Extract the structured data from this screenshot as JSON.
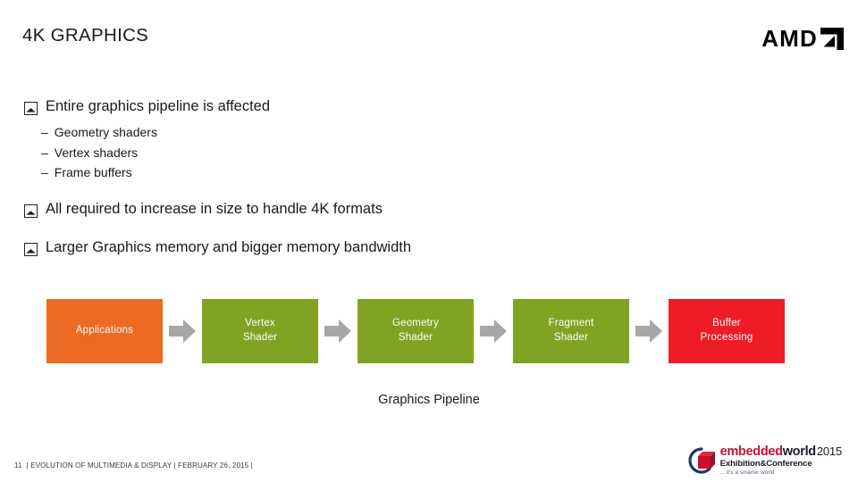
{
  "header": {
    "title": "4K GRAPHICS",
    "logo": {
      "name": "amd-logo",
      "wordmark": "AMD",
      "mark": "amd-arrow-icon"
    }
  },
  "content": {
    "bullets": [
      {
        "text": "Entire graphics pipeline is affected",
        "sub_items": [
          {
            "dash": "–",
            "text": "Geometry shaders"
          },
          {
            "dash": "–",
            "text": "Vertex shaders"
          },
          {
            "dash": "–",
            "text": "Frame buffers"
          }
        ]
      },
      {
        "text": "All required to increase in size to handle 4K formats",
        "sub_items": []
      },
      {
        "text": "Larger Graphics memory and bigger memory bandwidth",
        "sub_items": []
      }
    ],
    "bullet_glyph_name": "square-caret-bullet-icon"
  },
  "diagram": {
    "caption": "Graphics Pipeline",
    "arrow_color": "#A6A6A6",
    "stages": [
      {
        "label_lines": [
          "Applications"
        ],
        "color": "#ED6A23"
      },
      {
        "label_lines": [
          "Vertex",
          "Shader"
        ],
        "color": "#7FA423"
      },
      {
        "label_lines": [
          "Geometry",
          "Shader"
        ],
        "color": "#7FA423"
      },
      {
        "label_lines": [
          "Fragment",
          "Shader"
        ],
        "color": "#7FA423"
      },
      {
        "label_lines": [
          "Buffer",
          "Processing"
        ],
        "color": "#EE1C25"
      }
    ]
  },
  "footer": {
    "page_number": "11",
    "text": "|  EVOLUTION OF MULTIMEDIA & DISPLAY | FEBRUARY 26, 2015  |",
    "event_logo": {
      "embedded": "embedded",
      "world": "world",
      "year": "2015",
      "subtitle": "Exhibition&Conference",
      "tagline": "... it's a smarter world",
      "mark": "embedded-world-cube-icon"
    }
  }
}
